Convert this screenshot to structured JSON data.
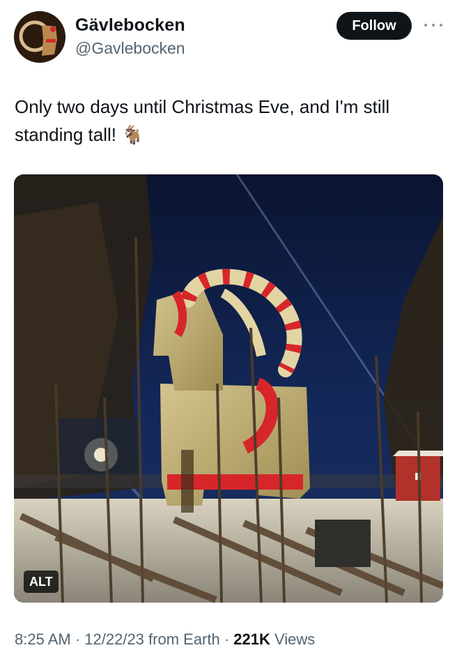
{
  "author": {
    "display_name": "Gävlebocken",
    "handle": "@Gavlebocken"
  },
  "follow_label": "Follow",
  "tweet": {
    "text": "Only two days until Christmas Eve, and I'm still standing tall! 🐐"
  },
  "media": {
    "alt_label": "ALT"
  },
  "meta": {
    "time": "8:25 AM",
    "separator": " · ",
    "date": "12/22/23",
    "source": " from Earth",
    "views_count": "221K",
    "views_label": " Views"
  },
  "icons": {
    "more": "more-horizontal-icon"
  },
  "colors": {
    "text_primary": "#0f1419",
    "text_secondary": "#536471",
    "follow_bg": "#0f1419"
  }
}
